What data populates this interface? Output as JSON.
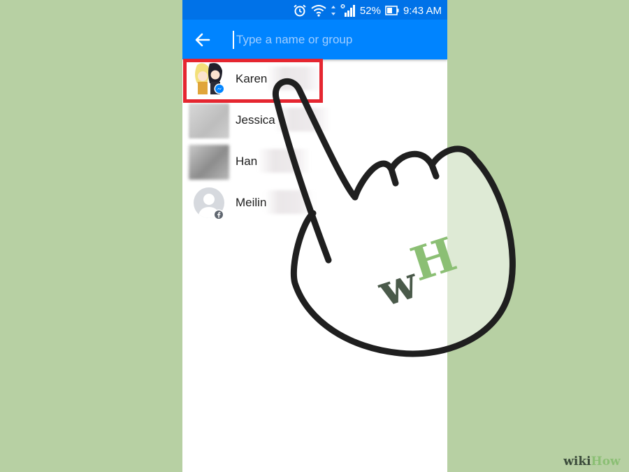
{
  "status_bar": {
    "battery_percent": "52%",
    "time": "9:43 AM",
    "icons": [
      "alarm-icon",
      "wifi-icon",
      "signal-icon",
      "battery-icon"
    ]
  },
  "search": {
    "placeholder": "Type a name or group",
    "value": ""
  },
  "contacts": [
    {
      "name": "Karen",
      "avatar": "anime-avatar",
      "badge": "messenger-badge"
    },
    {
      "name": "Jessica",
      "avatar": "blurred-photo"
    },
    {
      "name": "Han",
      "avatar": "blurred-photo"
    },
    {
      "name": "Meilin",
      "avatar": "default-avatar",
      "badge": "facebook-badge"
    }
  ],
  "watermark": {
    "logo_w": "w",
    "logo_h": "H",
    "badge_wiki": "wiki",
    "badge_how": "How"
  },
  "colors": {
    "background": "#b7d0a3",
    "header_blue": "#0084ff",
    "status_blue": "#0072e8",
    "highlight_red": "#e52630",
    "logo_dark": "#4a5a4a",
    "logo_green": "#8bbf74"
  }
}
